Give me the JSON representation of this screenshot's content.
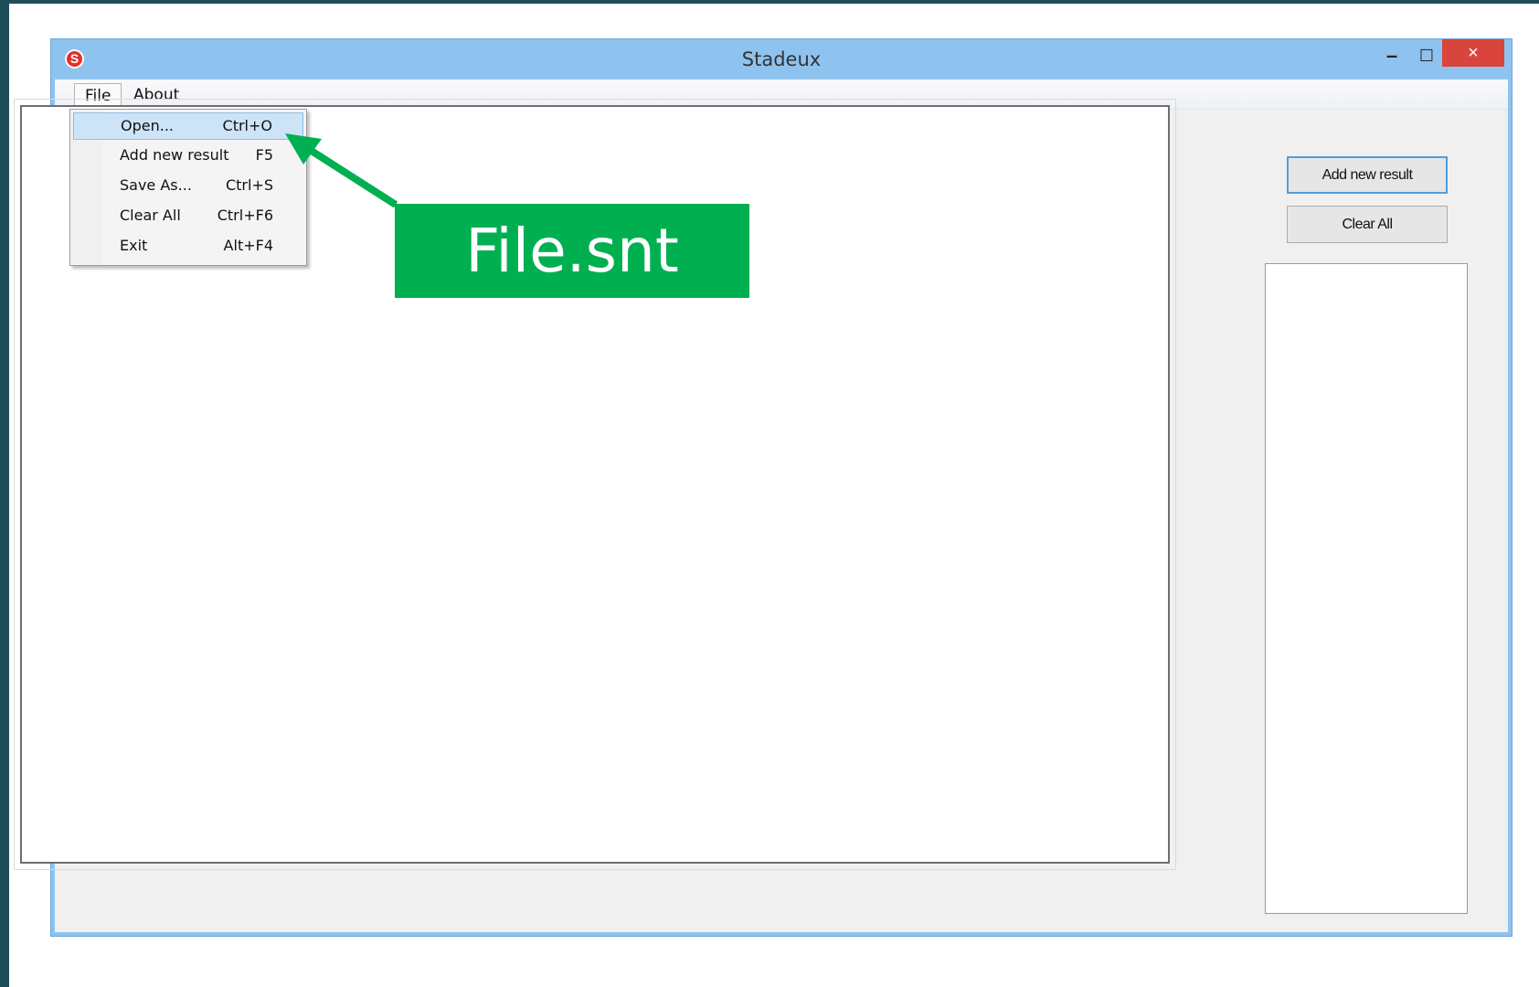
{
  "window": {
    "title": "Stadeux",
    "app_icon_letter": "S",
    "controls": {
      "minimize": "–",
      "maximize": "☐",
      "close": "×"
    }
  },
  "menubar": {
    "file": "File",
    "about": "About"
  },
  "file_menu": {
    "items": [
      {
        "label": "Open...",
        "shortcut": "Ctrl+O",
        "highlighted": true
      },
      {
        "label": "Add new result",
        "shortcut": "F5"
      },
      {
        "label": "Save As...",
        "shortcut": "Ctrl+S"
      },
      {
        "label": "Clear All",
        "shortcut": "Ctrl+F6"
      },
      {
        "label": "Exit",
        "shortcut": "Alt+F4"
      }
    ]
  },
  "buttons": {
    "add_new_result": "Add new result",
    "clear_all": "Clear All"
  },
  "annotation": {
    "callout_text": "File.snt",
    "color": "#00b050"
  },
  "colors": {
    "frame": "#1f4e5a",
    "window_border": "#8fc3ef",
    "close_button": "#d9453d",
    "menu_highlight": "#cde4f7"
  }
}
